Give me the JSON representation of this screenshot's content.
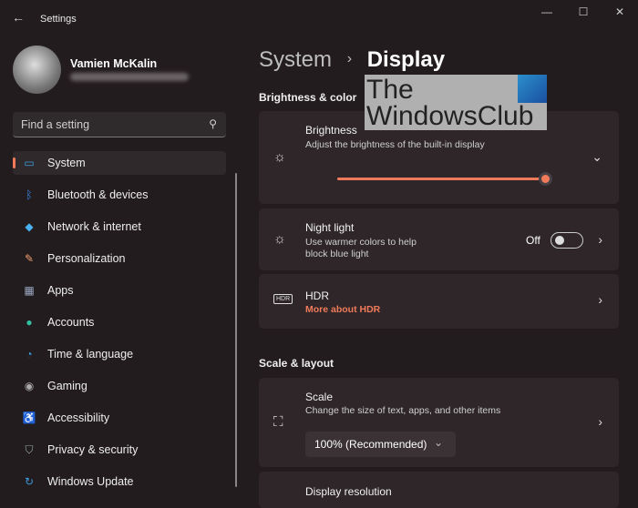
{
  "window": {
    "title": "Settings"
  },
  "user": {
    "name": "Vamien McKalin"
  },
  "search": {
    "placeholder": "Find a setting"
  },
  "nav": [
    {
      "label": "System",
      "icon": "monitor-icon"
    },
    {
      "label": "Bluetooth & devices",
      "icon": "bluetooth-icon"
    },
    {
      "label": "Network & internet",
      "icon": "wifi-icon"
    },
    {
      "label": "Personalization",
      "icon": "brush-icon"
    },
    {
      "label": "Apps",
      "icon": "apps-icon"
    },
    {
      "label": "Accounts",
      "icon": "person-icon"
    },
    {
      "label": "Time & language",
      "icon": "globe-icon"
    },
    {
      "label": "Gaming",
      "icon": "gamepad-icon"
    },
    {
      "label": "Accessibility",
      "icon": "accessibility-icon"
    },
    {
      "label": "Privacy & security",
      "icon": "shield-icon"
    },
    {
      "label": "Windows Update",
      "icon": "update-icon"
    }
  ],
  "breadcrumb": {
    "parent": "System",
    "sep": "›",
    "current": "Display"
  },
  "sections": {
    "brightness": "Brightness & color",
    "scale": "Scale & layout"
  },
  "brightness": {
    "title": "Brightness",
    "desc": "Adjust the brightness of the built-in display",
    "value": 100
  },
  "nightlight": {
    "title": "Night light",
    "desc1": "Use warmer colors to help",
    "desc2": "block blue light",
    "state": "Off"
  },
  "hdr": {
    "title": "HDR",
    "link": "More about HDR"
  },
  "scale": {
    "title": "Scale",
    "desc": "Change the size of text, apps, and other items",
    "value": "100% (Recommended)"
  },
  "resolution": {
    "title": "Display resolution"
  },
  "watermark": {
    "line1": "The",
    "line2": "WindowsClub"
  },
  "colors": {
    "accent": "#f07a5a"
  }
}
